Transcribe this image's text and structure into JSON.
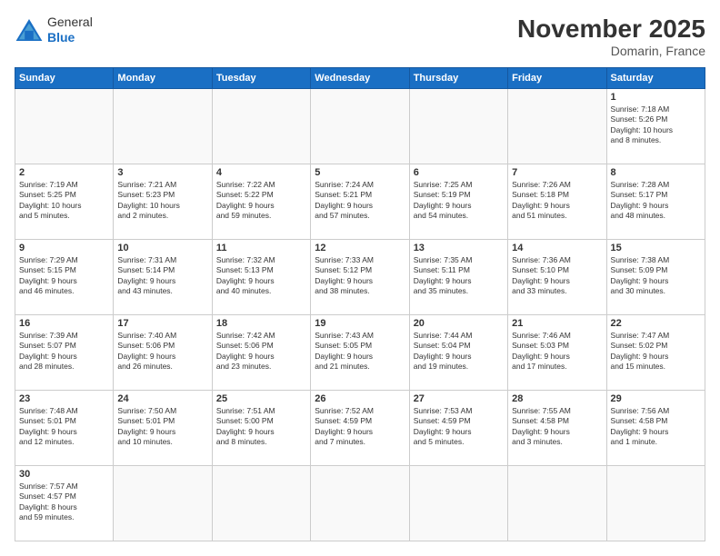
{
  "header": {
    "logo": {
      "general": "General",
      "blue": "Blue"
    },
    "title": "November 2025",
    "location": "Domarin, France"
  },
  "days_of_week": [
    "Sunday",
    "Monday",
    "Tuesday",
    "Wednesday",
    "Thursday",
    "Friday",
    "Saturday"
  ],
  "weeks": [
    [
      {
        "day": "",
        "info": ""
      },
      {
        "day": "",
        "info": ""
      },
      {
        "day": "",
        "info": ""
      },
      {
        "day": "",
        "info": ""
      },
      {
        "day": "",
        "info": ""
      },
      {
        "day": "",
        "info": ""
      },
      {
        "day": "1",
        "info": "Sunrise: 7:18 AM\nSunset: 5:26 PM\nDaylight: 10 hours\nand 8 minutes."
      }
    ],
    [
      {
        "day": "2",
        "info": "Sunrise: 7:19 AM\nSunset: 5:25 PM\nDaylight: 10 hours\nand 5 minutes."
      },
      {
        "day": "3",
        "info": "Sunrise: 7:21 AM\nSunset: 5:23 PM\nDaylight: 10 hours\nand 2 minutes."
      },
      {
        "day": "4",
        "info": "Sunrise: 7:22 AM\nSunset: 5:22 PM\nDaylight: 9 hours\nand 59 minutes."
      },
      {
        "day": "5",
        "info": "Sunrise: 7:24 AM\nSunset: 5:21 PM\nDaylight: 9 hours\nand 57 minutes."
      },
      {
        "day": "6",
        "info": "Sunrise: 7:25 AM\nSunset: 5:19 PM\nDaylight: 9 hours\nand 54 minutes."
      },
      {
        "day": "7",
        "info": "Sunrise: 7:26 AM\nSunset: 5:18 PM\nDaylight: 9 hours\nand 51 minutes."
      },
      {
        "day": "8",
        "info": "Sunrise: 7:28 AM\nSunset: 5:17 PM\nDaylight: 9 hours\nand 48 minutes."
      }
    ],
    [
      {
        "day": "9",
        "info": "Sunrise: 7:29 AM\nSunset: 5:15 PM\nDaylight: 9 hours\nand 46 minutes."
      },
      {
        "day": "10",
        "info": "Sunrise: 7:31 AM\nSunset: 5:14 PM\nDaylight: 9 hours\nand 43 minutes."
      },
      {
        "day": "11",
        "info": "Sunrise: 7:32 AM\nSunset: 5:13 PM\nDaylight: 9 hours\nand 40 minutes."
      },
      {
        "day": "12",
        "info": "Sunrise: 7:33 AM\nSunset: 5:12 PM\nDaylight: 9 hours\nand 38 minutes."
      },
      {
        "day": "13",
        "info": "Sunrise: 7:35 AM\nSunset: 5:11 PM\nDaylight: 9 hours\nand 35 minutes."
      },
      {
        "day": "14",
        "info": "Sunrise: 7:36 AM\nSunset: 5:10 PM\nDaylight: 9 hours\nand 33 minutes."
      },
      {
        "day": "15",
        "info": "Sunrise: 7:38 AM\nSunset: 5:09 PM\nDaylight: 9 hours\nand 30 minutes."
      }
    ],
    [
      {
        "day": "16",
        "info": "Sunrise: 7:39 AM\nSunset: 5:07 PM\nDaylight: 9 hours\nand 28 minutes."
      },
      {
        "day": "17",
        "info": "Sunrise: 7:40 AM\nSunset: 5:06 PM\nDaylight: 9 hours\nand 26 minutes."
      },
      {
        "day": "18",
        "info": "Sunrise: 7:42 AM\nSunset: 5:06 PM\nDaylight: 9 hours\nand 23 minutes."
      },
      {
        "day": "19",
        "info": "Sunrise: 7:43 AM\nSunset: 5:05 PM\nDaylight: 9 hours\nand 21 minutes."
      },
      {
        "day": "20",
        "info": "Sunrise: 7:44 AM\nSunset: 5:04 PM\nDaylight: 9 hours\nand 19 minutes."
      },
      {
        "day": "21",
        "info": "Sunrise: 7:46 AM\nSunset: 5:03 PM\nDaylight: 9 hours\nand 17 minutes."
      },
      {
        "day": "22",
        "info": "Sunrise: 7:47 AM\nSunset: 5:02 PM\nDaylight: 9 hours\nand 15 minutes."
      }
    ],
    [
      {
        "day": "23",
        "info": "Sunrise: 7:48 AM\nSunset: 5:01 PM\nDaylight: 9 hours\nand 12 minutes."
      },
      {
        "day": "24",
        "info": "Sunrise: 7:50 AM\nSunset: 5:01 PM\nDaylight: 9 hours\nand 10 minutes."
      },
      {
        "day": "25",
        "info": "Sunrise: 7:51 AM\nSunset: 5:00 PM\nDaylight: 9 hours\nand 8 minutes."
      },
      {
        "day": "26",
        "info": "Sunrise: 7:52 AM\nSunset: 4:59 PM\nDaylight: 9 hours\nand 7 minutes."
      },
      {
        "day": "27",
        "info": "Sunrise: 7:53 AM\nSunset: 4:59 PM\nDaylight: 9 hours\nand 5 minutes."
      },
      {
        "day": "28",
        "info": "Sunrise: 7:55 AM\nSunset: 4:58 PM\nDaylight: 9 hours\nand 3 minutes."
      },
      {
        "day": "29",
        "info": "Sunrise: 7:56 AM\nSunset: 4:58 PM\nDaylight: 9 hours\nand 1 minute."
      }
    ],
    [
      {
        "day": "30",
        "info": "Sunrise: 7:57 AM\nSunset: 4:57 PM\nDaylight: 8 hours\nand 59 minutes."
      },
      {
        "day": "",
        "info": ""
      },
      {
        "day": "",
        "info": ""
      },
      {
        "day": "",
        "info": ""
      },
      {
        "day": "",
        "info": ""
      },
      {
        "day": "",
        "info": ""
      },
      {
        "day": "",
        "info": ""
      }
    ]
  ]
}
